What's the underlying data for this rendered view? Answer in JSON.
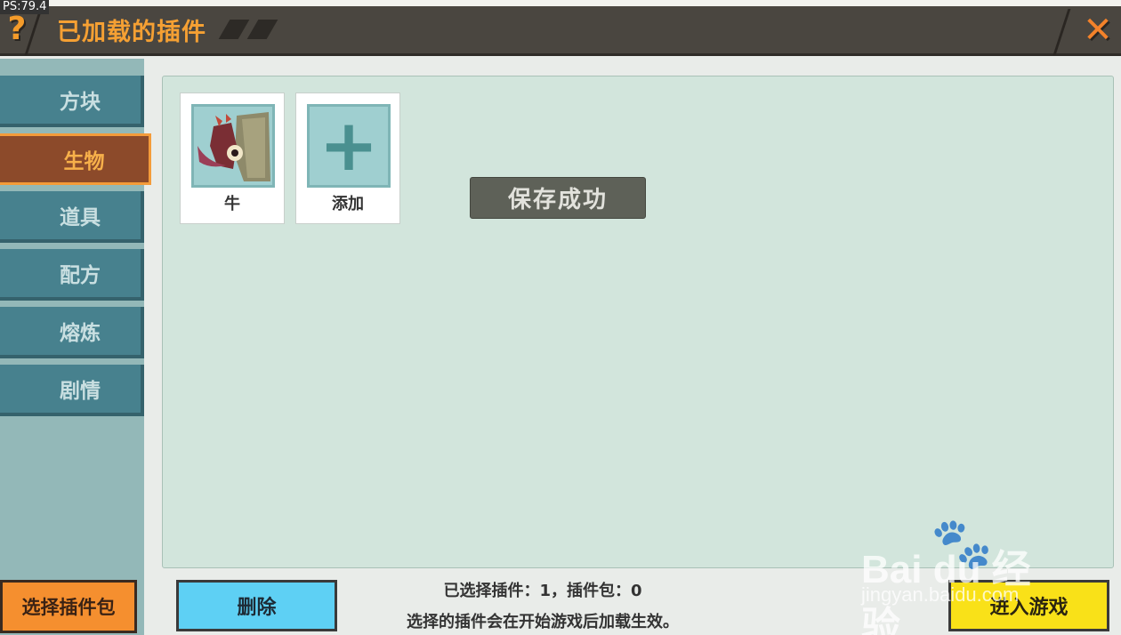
{
  "fps": "PS:79.4",
  "header": {
    "help_icon": "?",
    "title": "已加载的插件",
    "close_icon": "✕"
  },
  "sidebar": {
    "tabs": [
      {
        "label": "方块",
        "active": false
      },
      {
        "label": "生物",
        "active": true
      },
      {
        "label": "道具",
        "active": false
      },
      {
        "label": "配方",
        "active": false
      },
      {
        "label": "熔炼",
        "active": false
      },
      {
        "label": "剧情",
        "active": false
      }
    ]
  },
  "plugins": {
    "items": [
      {
        "label": "牛"
      },
      {
        "label": "添加"
      }
    ]
  },
  "toast": "保存成功",
  "buttons": {
    "select_pack": "选择插件包",
    "delete": "删除",
    "enter_game": "进入游戏"
  },
  "info": {
    "line1": "已选择插件：1，插件包：0",
    "line2": "选择的插件会在开始游戏后加载生效。"
  },
  "watermark": {
    "brand": "Bai du 经验",
    "url": "jingyan.baidu.com"
  },
  "colors": {
    "header_bg": "#4a4640",
    "title_orange": "#f5a033",
    "tab_bg": "#47818e",
    "tab_active_bg": "#8c4a2a",
    "panel_bg": "#d2e5dc",
    "delete_blue": "#5ed0f4",
    "enter_yellow": "#f9e118",
    "pack_orange": "#f58f2f"
  }
}
